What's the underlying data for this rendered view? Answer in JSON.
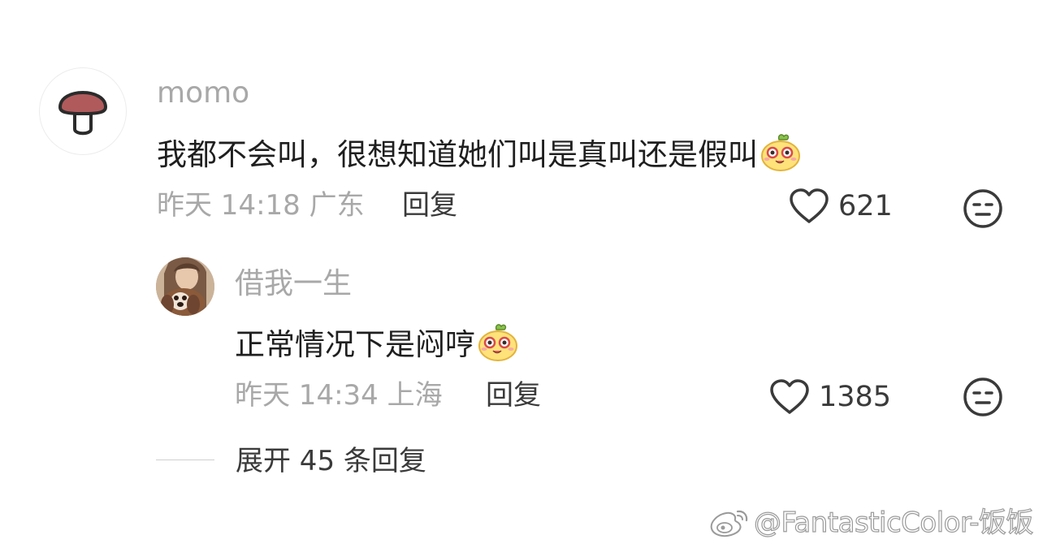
{
  "comment": {
    "username": "momo",
    "text": "我都不会叫，很想知道她们叫是真叫还是假叫",
    "emoji": "cute-yellow-emoji",
    "time": "昨天 14:18",
    "location": "广东",
    "reply_label": "回复",
    "likes": "621"
  },
  "reply": {
    "username": "借我一生",
    "text": "正常情况下是闷哼",
    "emoji": "cute-yellow-emoji",
    "time": "昨天 14:34",
    "location": "上海",
    "reply_label": "回复",
    "likes": "1385"
  },
  "expand_label": "展开 45 条回复",
  "watermark": "@FantasticColor-饭饭",
  "colors": {
    "text_primary": "#1f1f1f",
    "text_secondary": "#a8a8a8",
    "text_action": "#3a3a3a",
    "background": "#ffffff"
  }
}
